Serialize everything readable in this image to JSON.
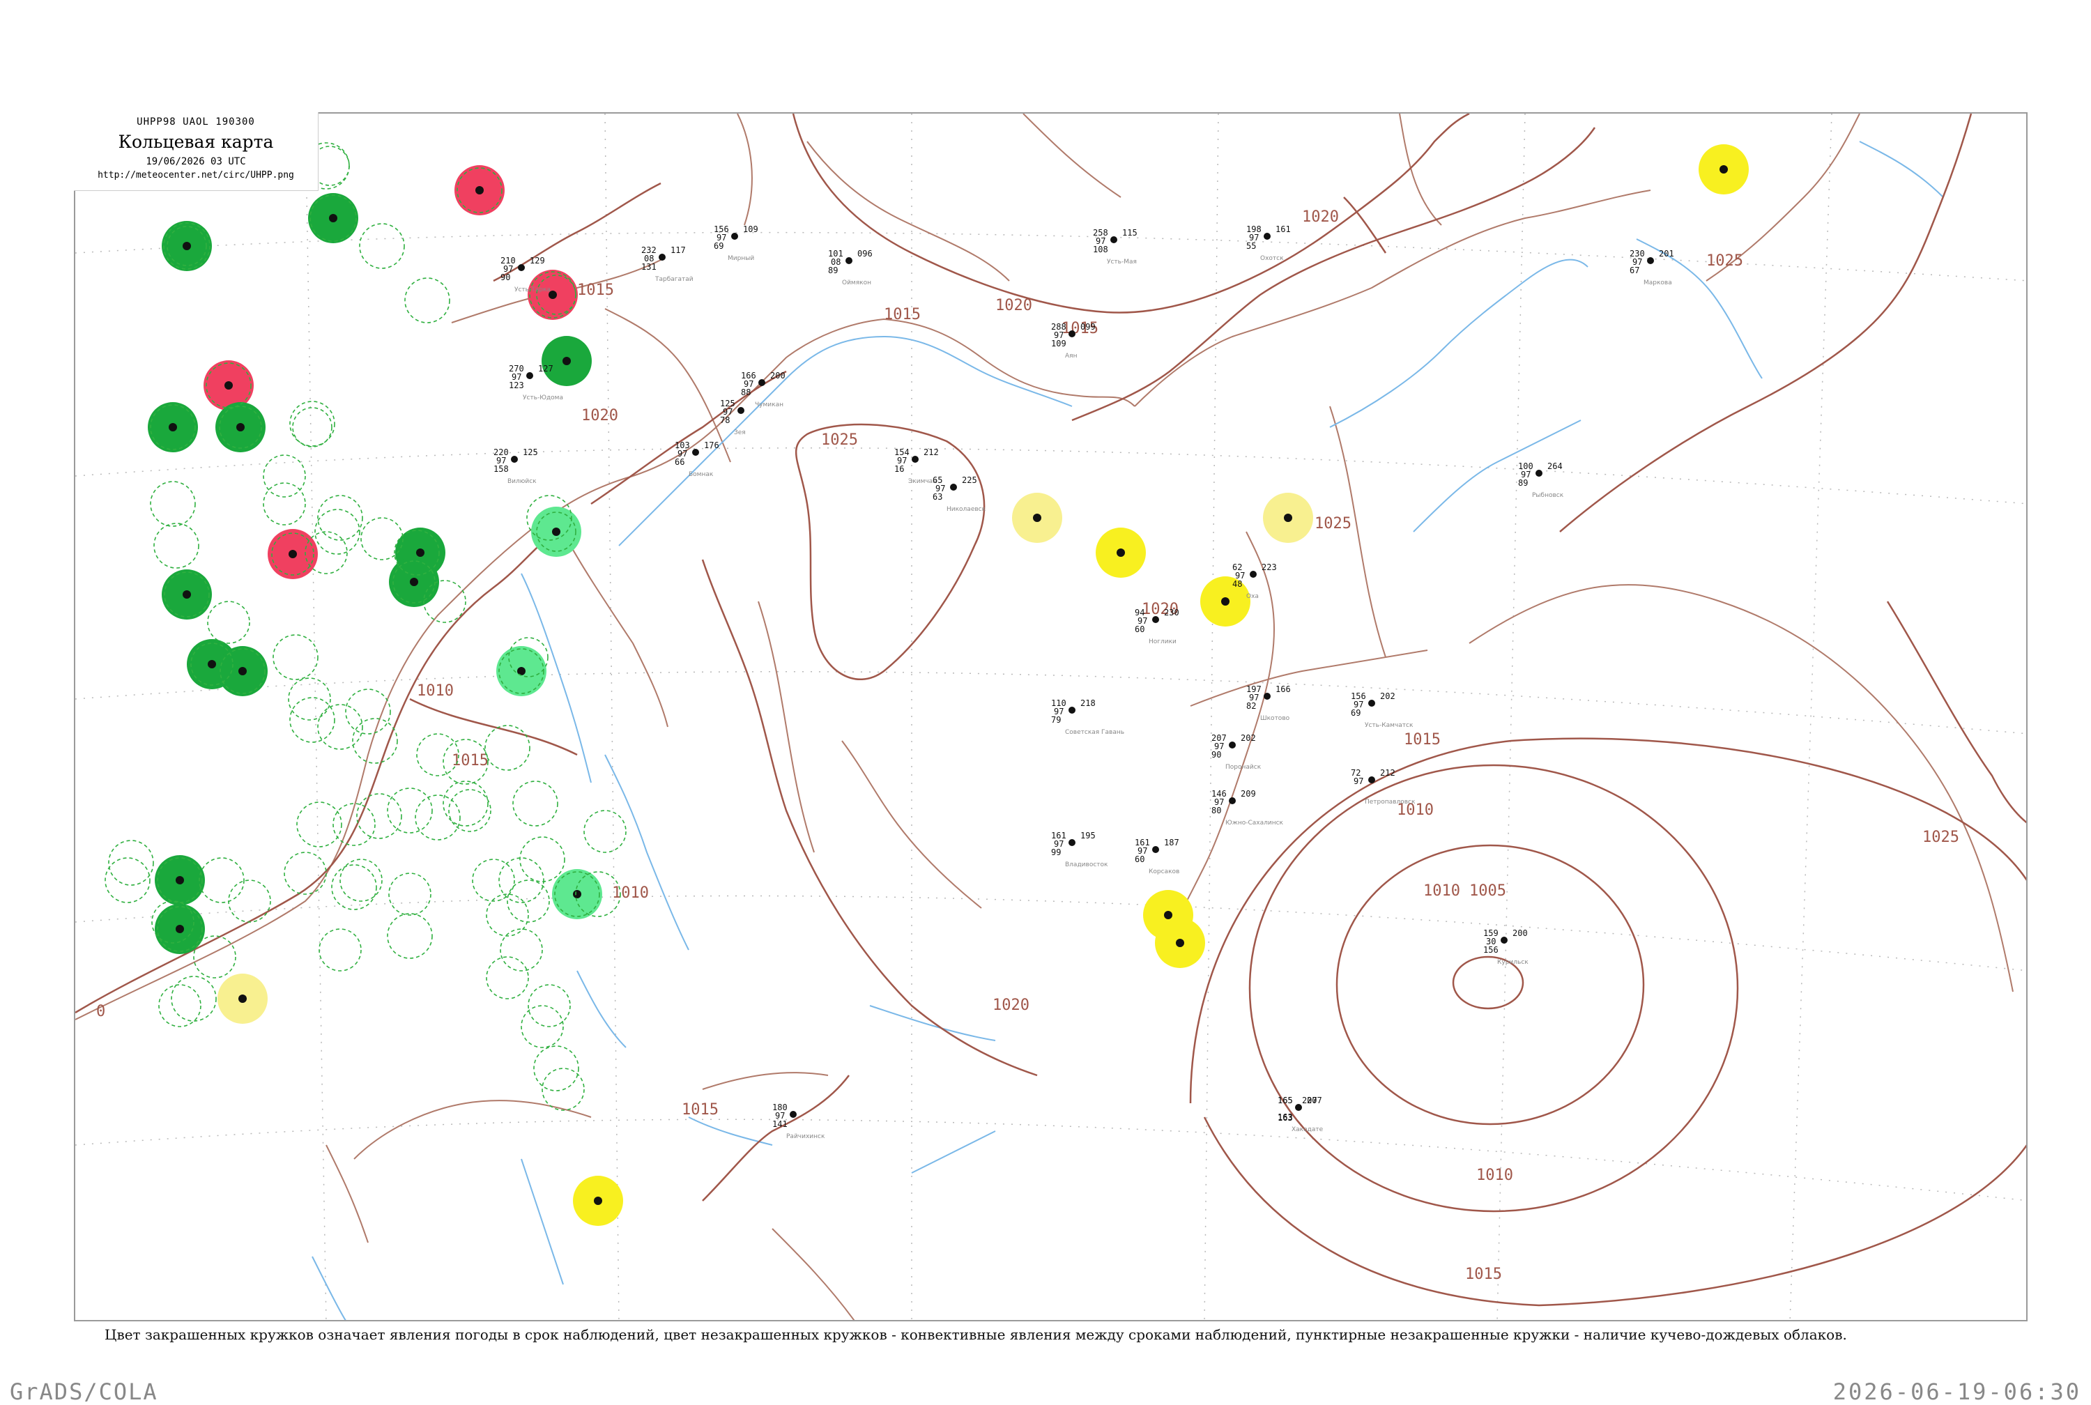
{
  "header": {
    "code": "UHPP98  UAOL  190300",
    "title": "Кольцевая карта",
    "datetime": "19/06/2026 03 UTC",
    "url": "http://meteocenter.net/circ/UHPP.png"
  },
  "caption": "Цвет закрашенных кружков означает явления погоды в срок наблюдений, цвет незакрашенных кружков - конвективные явления между сроками наблюдений, пунктирные незакрашенные кружки - наличие кучево-дождевых облаков.",
  "footer": {
    "left": "GrADS/COLA",
    "right": "2026-06-19-06:30"
  },
  "colors": {
    "isobar": "#a0574a",
    "coast": "#b07a6a",
    "river": "#7ab8e8",
    "green": "#1aa83c",
    "light_green": "#5ee890",
    "red": "#f04060",
    "yellow": "#f8f020",
    "light_yellow": "#f8f090",
    "dashed_green": "#30b040"
  },
  "isobar_labels": [
    "1020",
    "1015",
    "1025",
    "1020",
    "1020",
    "1015",
    "1025",
    "1025",
    "1020",
    "1015",
    "1010",
    "1010",
    "1005",
    "1010",
    "1015",
    "1020",
    "1015",
    "1015",
    "1010",
    "1025",
    "0",
    "1010",
    "1015"
  ],
  "stations": [
    {
      "id": "s1",
      "fill": "green",
      "t": "",
      "p": "",
      "w": "",
      "name": ""
    },
    {
      "id": "s2",
      "fill": "red",
      "t": "",
      "p": "",
      "w": "",
      "name": ""
    },
    {
      "id": "s3",
      "fill": "green",
      "t": "",
      "p": "",
      "w": "",
      "name": ""
    },
    {
      "id": "s4",
      "fill": "red",
      "t": "",
      "p": "",
      "w": "",
      "name": ""
    },
    {
      "id": "s5",
      "fill": "green",
      "t": "",
      "p": "",
      "w": "",
      "name": ""
    },
    {
      "id": "s6",
      "fill": "red",
      "t": "",
      "p": "",
      "w": "",
      "name": ""
    },
    {
      "id": "s7",
      "fill": "green",
      "t": "",
      "p": "",
      "w": "",
      "name": ""
    },
    {
      "id": "s8",
      "fill": "red",
      "t": "",
      "p": "",
      "w": "",
      "name": ""
    },
    {
      "id": "s9",
      "fill": "green",
      "t": "",
      "p": "",
      "w": "",
      "name": ""
    },
    {
      "id": "s10",
      "fill": "green",
      "t": "",
      "p": "",
      "w": "",
      "name": ""
    },
    {
      "id": "s11",
      "fill": "green",
      "t": "",
      "p": "",
      "w": "",
      "name": ""
    },
    {
      "id": "s12",
      "fill": "green",
      "t": "",
      "p": "",
      "w": "",
      "name": ""
    },
    {
      "id": "s13",
      "fill": "green",
      "t": "",
      "p": "",
      "w": "",
      "name": ""
    },
    {
      "id": "s14",
      "fill": "green",
      "t": "",
      "p": "",
      "w": "",
      "name": ""
    },
    {
      "id": "s15",
      "fill": "green",
      "t": "",
      "p": "",
      "w": "",
      "name": ""
    },
    {
      "id": "s16",
      "fill": "green",
      "t": "",
      "p": "",
      "w": "",
      "name": ""
    },
    {
      "id": "s17",
      "fill": "light_green",
      "t": "",
      "p": "",
      "w": "",
      "name": ""
    },
    {
      "id": "s18",
      "fill": "light_green",
      "t": "",
      "p": "",
      "w": "",
      "name": ""
    },
    {
      "id": "s19",
      "fill": "light_green",
      "t": "",
      "p": "",
      "w": "",
      "name": ""
    },
    {
      "id": "s20",
      "fill": "yellow",
      "t": "",
      "p": "",
      "w": "",
      "name": ""
    },
    {
      "id": "s21",
      "fill": "yellow",
      "t": "",
      "p": "",
      "w": "",
      "name": ""
    },
    {
      "id": "s22",
      "fill": "yellow",
      "t": "",
      "p": "",
      "w": "",
      "name": ""
    },
    {
      "id": "s23",
      "fill": "yellow",
      "t": "",
      "p": "",
      "w": "",
      "name": ""
    },
    {
      "id": "s24",
      "fill": "light_yellow",
      "t": "",
      "p": "",
      "w": "",
      "name": ""
    },
    {
      "id": "s25",
      "fill": "light_yellow",
      "t": "",
      "p": "",
      "w": "",
      "name": ""
    },
    {
      "id": "s26",
      "fill": "light_yellow",
      "t": "",
      "p": "",
      "w": "",
      "name": ""
    },
    {
      "id": "s27",
      "fill": "yellow",
      "t": "",
      "p": "",
      "w": "",
      "name": ""
    },
    {
      "id": "s28",
      "fill": "yellow",
      "t": "",
      "p": "",
      "w": "",
      "name": ""
    }
  ],
  "station_labels": [
    {
      "id": "l1",
      "t": "232",
      "p": "117",
      "w": "08",
      "n": "131",
      "name": "Тарбагатай"
    },
    {
      "id": "l2",
      "t": "156",
      "p": "109",
      "w": "97",
      "n": "69",
      "name": "Мирный"
    },
    {
      "id": "l3",
      "t": "101",
      "p": "096",
      "w": "08",
      "n": "89",
      "name": "Оймякон"
    },
    {
      "id": "l4",
      "t": "258",
      "p": "115",
      "w": "97",
      "n": "108",
      "name": "Усть-Мая"
    },
    {
      "id": "l5",
      "t": "198",
      "p": "161",
      "w": "97",
      "n": "55",
      "name": "Охотск"
    },
    {
      "id": "l6",
      "t": "230",
      "p": "201",
      "w": "97",
      "n": "67",
      "name": "Маркова"
    },
    {
      "id": "l7",
      "t": "210",
      "p": "129",
      "w": "97",
      "n": "90",
      "name": "Усть-Тарка"
    },
    {
      "id": "l8",
      "t": "288",
      "p": "099",
      "w": "97",
      "n": "109",
      "name": "Аян"
    },
    {
      "id": "l9",
      "t": "270",
      "p": "127",
      "w": "97",
      "n": "123",
      "name": "Усть-Юдома"
    },
    {
      "id": "l10",
      "t": "166",
      "p": "200",
      "w": "97",
      "n": "88",
      "name": "Чумикан"
    },
    {
      "id": "l11",
      "t": "125",
      "p": "",
      "w": "97",
      "n": "78",
      "name": "Зея"
    },
    {
      "id": "l12",
      "t": "103",
      "p": "176",
      "w": "97",
      "n": "66",
      "name": "Бомнак"
    },
    {
      "id": "l13",
      "t": "154",
      "p": "212",
      "w": "97",
      "n": "16",
      "name": "Экимчан"
    },
    {
      "id": "l14",
      "t": "65",
      "p": "225",
      "w": "97",
      "n": "63",
      "name": "Николаевск"
    },
    {
      "id": "l15",
      "t": "100",
      "p": "264",
      "w": "97",
      "n": "89",
      "name": "Рыбновск"
    },
    {
      "id": "l16",
      "t": "220",
      "p": "125",
      "w": "97",
      "n": "158",
      "name": "Вилюйск"
    },
    {
      "id": "l17",
      "t": "62",
      "p": "223",
      "w": "97",
      "n": "48",
      "name": "Оха"
    },
    {
      "id": "l18",
      "t": "94",
      "p": "230",
      "w": "97",
      "n": "60",
      "name": "Ноглики"
    },
    {
      "id": "l19",
      "t": "197",
      "p": "166",
      "w": "97",
      "n": "82",
      "name": "Шкотово"
    },
    {
      "id": "l20",
      "t": "156",
      "p": "202",
      "w": "97",
      "n": "69",
      "name": "Усть-Камчатск"
    },
    {
      "id": "l21",
      "t": "110",
      "p": "218",
      "w": "97",
      "n": "79",
      "name": "Советская Гавань"
    },
    {
      "id": "l22",
      "t": "207",
      "p": "202",
      "w": "97",
      "n": "90",
      "name": "Поронайск"
    },
    {
      "id": "l23",
      "t": "72",
      "p": "212",
      "w": "97",
      "n": "",
      "name": "Петропавловск"
    },
    {
      "id": "l24",
      "t": "146",
      "p": "209",
      "w": "97",
      "n": "80",
      "name": "Южно-Сахалинск"
    },
    {
      "id": "l25",
      "t": "161",
      "p": "195",
      "w": "97",
      "n": "99",
      "name": "Владивосток"
    },
    {
      "id": "l26",
      "t": "161",
      "p": "187",
      "w": "97",
      "n": "60",
      "name": "Корсаков"
    },
    {
      "id": "l27",
      "t": "159",
      "p": "200",
      "w": "30",
      "n": "156",
      "name": "Курильск"
    },
    {
      "id": "l28",
      "t": "180",
      "p": "",
      "w": "97",
      "n": "141",
      "name": "Райчихинск"
    },
    {
      "id": "l29",
      "t": "165",
      "p": "207",
      "w": "",
      "n": "163",
      "name": "Хакодате"
    }
  ]
}
